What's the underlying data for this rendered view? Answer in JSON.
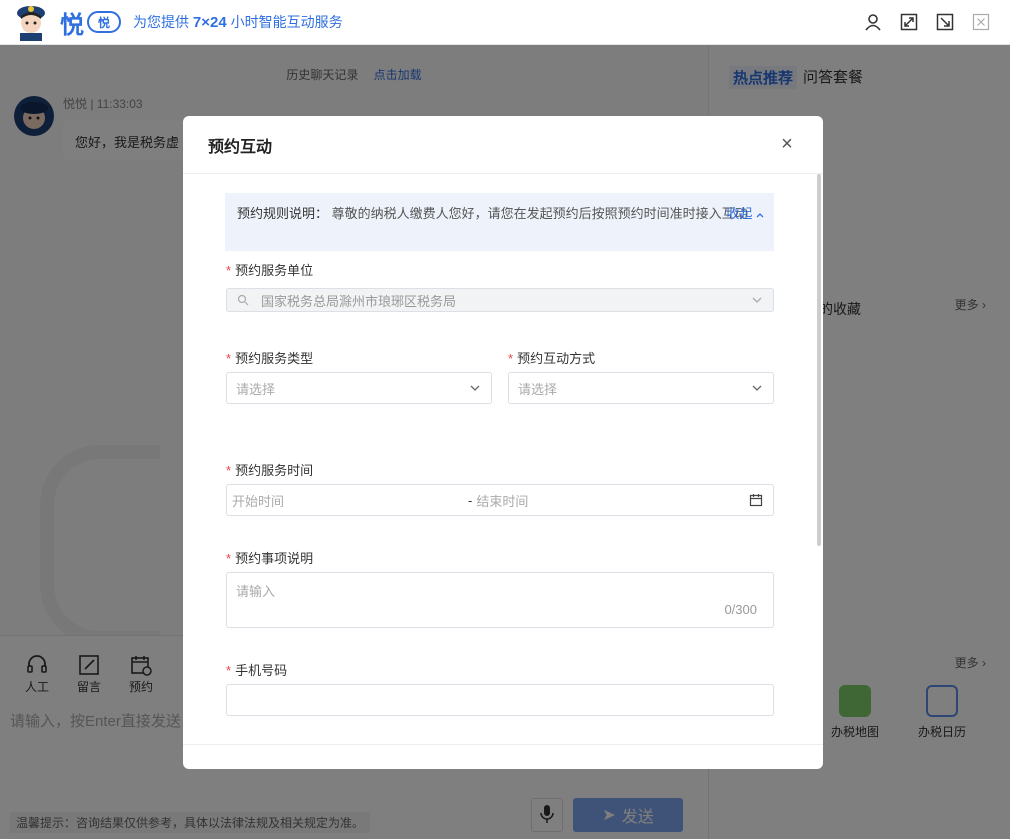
{
  "header": {
    "logo": "悦",
    "badge": "悦",
    "slogan_prefix": "为您提供 ",
    "slogan_bold": "7×24",
    "slogan_suffix": " 小时智能互动服务",
    "icons": [
      "user-icon",
      "expand-icon",
      "minimize-icon",
      "close-icon"
    ]
  },
  "chat": {
    "history_label": "历史聊天记录",
    "load_more": "点击加载",
    "sender": "悦悦 | 11:33:03",
    "message": "您好，我是税务虚"
  },
  "right_panel": {
    "tab_hot": "热点推荐",
    "tab_qa": "问答套餐",
    "favorites": "的收藏",
    "more1": "更多 ›",
    "more2": "更多 ›",
    "tools": [
      {
        "label": "办税地图",
        "icon": "map-pin-icon"
      },
      {
        "label": "办税日历",
        "icon": "calendar-icon"
      }
    ]
  },
  "bottom": {
    "tools": [
      {
        "label": "人工",
        "icon": "headset-icon"
      },
      {
        "label": "留言",
        "icon": "edit-icon"
      },
      {
        "label": "预约",
        "icon": "calendar-clock-icon"
      }
    ],
    "input_placeholder": "请输入，按Enter直接发送",
    "tip": "温馨提示：咨询结果仅供参考，具体以法律法规及相关规定为准。",
    "send_label": "发送"
  },
  "modal": {
    "title": "预约互动",
    "close": "×",
    "notice_label": "预约规则说明：",
    "notice_text": " 尊敬的纳税人缴费人您好，请您在发起预约后按照预约时间准时接入互动",
    "collapse": "收起",
    "unit_label": "预约服务单位",
    "unit_value": "国家税务总局滁州市琅琊区税务局",
    "type_label": "预约服务类型",
    "type_placeholder": "请选择",
    "mode_label": "预约互动方式",
    "mode_placeholder": "请选择",
    "time_label": "预约服务时间",
    "time_start": "开始时间",
    "time_sep": "-",
    "time_end": "结束时间",
    "desc_label": "预约事项说明",
    "desc_placeholder": "请输入",
    "desc_count": "0/300",
    "phone_label": "手机号码",
    "required_mark": "*"
  }
}
